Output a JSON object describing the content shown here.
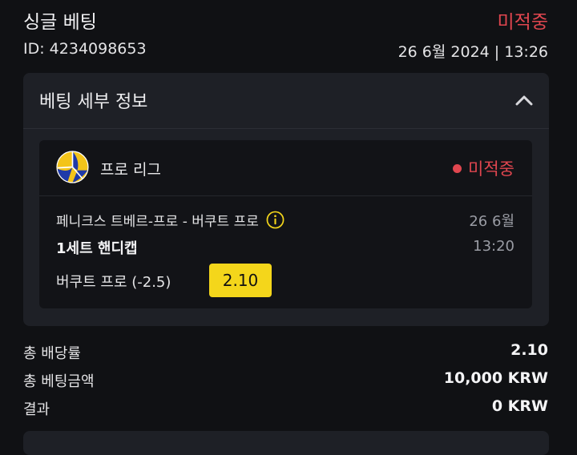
{
  "header": {
    "title": "싱글 베팅",
    "status": "미적중",
    "id_text": "ID: 4234098653",
    "datetime": "26 6월 2024 | 13:26"
  },
  "details": {
    "title": "베팅 세부 정보",
    "collapse_icon": "chevron-up-icon",
    "event": {
      "sport_icon": "volleyball-icon",
      "league": "프로 리그",
      "status": "미적중",
      "status_color": "#e0464f",
      "match": "페니크스 트베르-프로 - 버쿠트 프로",
      "info_icon": "info-icon",
      "date": "26 6월",
      "market": "1세트 핸디캡",
      "time": "13:20",
      "selection": "버쿠트 프로 (-2.5)",
      "odds": "2.10",
      "odds_color": "#f4d61b"
    }
  },
  "summary": {
    "rows": [
      {
        "label": "총 배당률",
        "value": "2.10"
      },
      {
        "label": "총 베팅금액",
        "value": "10,000 KRW"
      },
      {
        "label": "결과",
        "value": "0 KRW"
      }
    ]
  }
}
